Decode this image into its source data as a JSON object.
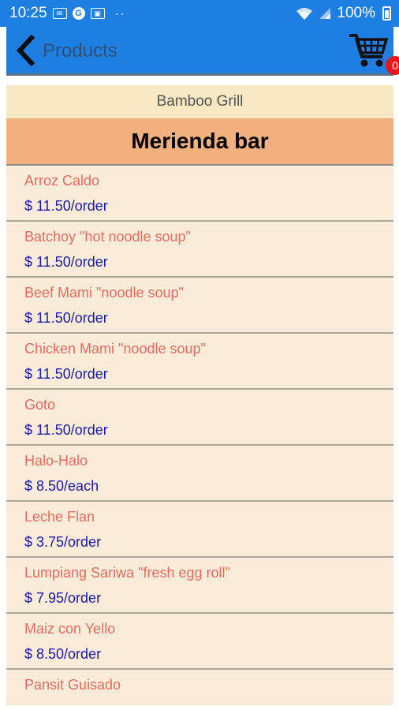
{
  "status_bar": {
    "time": "10:25",
    "battery": "100%"
  },
  "app_bar": {
    "title": "Products",
    "cart_count": "0"
  },
  "restaurant": "Bamboo Grill",
  "category": "Merienda bar",
  "products": [
    {
      "name": "Arroz Caldo",
      "price": "$ 11.50/order"
    },
    {
      "name": "Batchoy \"hot noodle soup\"",
      "price": "$ 11.50/order"
    },
    {
      "name": "Beef Mami \"noodle soup\"",
      "price": "$ 11.50/order"
    },
    {
      "name": "Chicken Mami \"noodle soup\"",
      "price": "$ 11.50/order"
    },
    {
      "name": "Goto",
      "price": "$ 11.50/order"
    },
    {
      "name": "Halo-Halo",
      "price": "$ 8.50/each"
    },
    {
      "name": "Leche Flan",
      "price": "$ 3.75/order"
    },
    {
      "name": "Lumpiang Sariwa \"fresh egg roll\"",
      "price": "$ 7.95/order"
    },
    {
      "name": "Maiz con Yello",
      "price": "$ 8.50/order"
    },
    {
      "name": "Pansit Guisado",
      "price": ""
    }
  ],
  "colors": {
    "status_bar": "#1e7fe2",
    "app_bar": "#1e7fe2",
    "restaurant_header": "#f7e7c2",
    "category_header": "#f2b07e",
    "list_background": "#fbebd9",
    "product_name": "#e36b5f",
    "product_price": "#1a1aa8",
    "badge": "#e8161c"
  },
  "icons": [
    "mail-icon",
    "g-app-icon",
    "image-icon",
    "wifi-icon",
    "signal-icon",
    "battery-icon",
    "back-chevron-icon",
    "cart-icon"
  ]
}
